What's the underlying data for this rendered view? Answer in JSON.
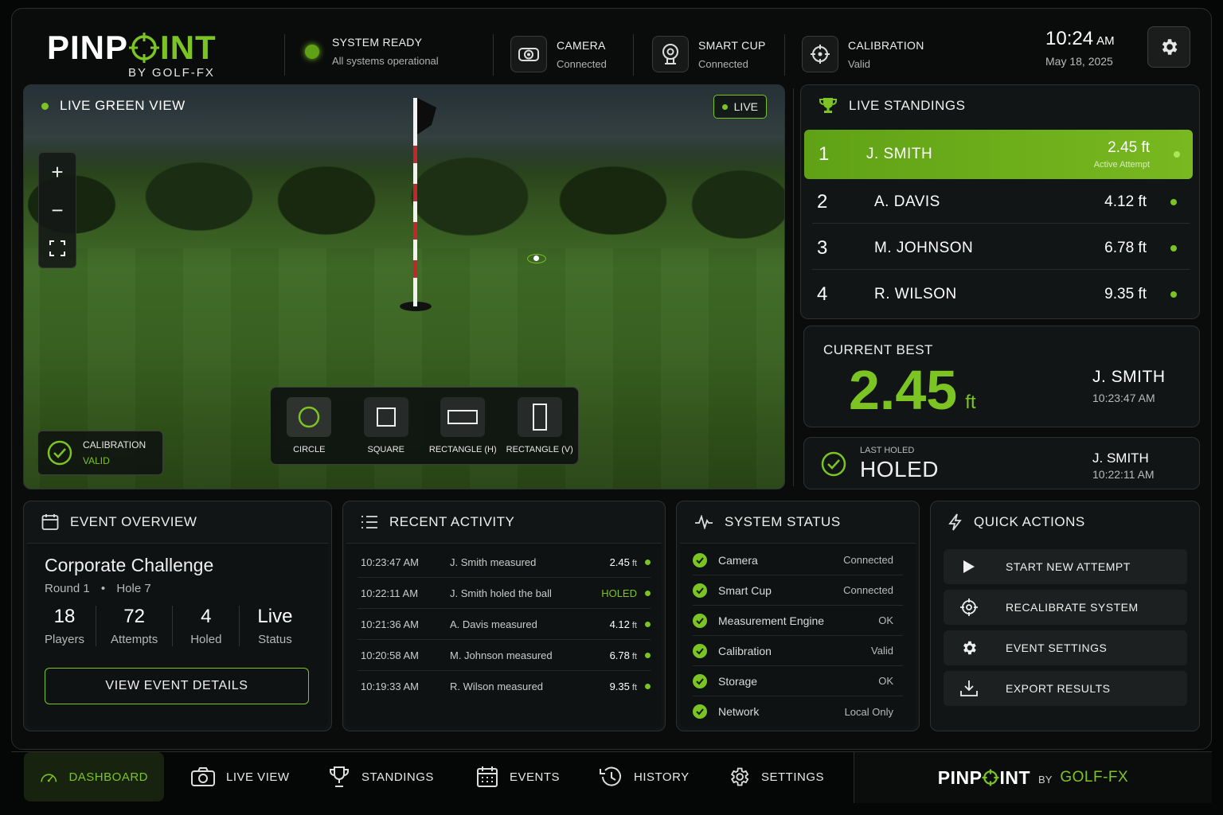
{
  "brand": {
    "name_a": "PINP",
    "name_b": "INT",
    "by": "BY GOLF-FX",
    "footer_by": "BY",
    "footer_brand": "GOLF-FX"
  },
  "header": {
    "system": {
      "title": "SYSTEM READY",
      "subtitle": "All systems operational"
    },
    "camera": {
      "title": "CAMERA",
      "subtitle": "Connected"
    },
    "cup": {
      "title": "SMART CUP",
      "subtitle": "Connected"
    },
    "calibration": {
      "title": "CALIBRATION",
      "subtitle": "Valid"
    },
    "time": "10:24",
    "ampm": "AM",
    "date": "May 18, 2025"
  },
  "green_view": {
    "title": "LIVE GREEN VIEW",
    "live_badge": "LIVE",
    "calibration": {
      "label": "CALIBRATION",
      "value": "VALID"
    },
    "shapes": [
      {
        "label": "CIRCLE",
        "icon": "circle-icon"
      },
      {
        "label": "SQUARE",
        "icon": "square-icon"
      },
      {
        "label": "RECTANGLE (H)",
        "icon": "rectangle-h-icon"
      },
      {
        "label": "RECTANGLE (V)",
        "icon": "rectangle-v-icon"
      }
    ]
  },
  "standings": {
    "title": "LIVE STANDINGS",
    "rows": [
      {
        "rank": "1",
        "name": "J. SMITH",
        "distance": "2.45 ft",
        "note": "Active Attempt"
      },
      {
        "rank": "2",
        "name": "A. DAVIS",
        "distance": "4.12 ft"
      },
      {
        "rank": "3",
        "name": "M. JOHNSON",
        "distance": "6.78 ft"
      },
      {
        "rank": "4",
        "name": "R. WILSON",
        "distance": "9.35 ft"
      }
    ]
  },
  "current_best": {
    "label": "CURRENT BEST",
    "value": "2.45",
    "unit": "ft",
    "name": "J. SMITH",
    "time": "10:23:47 AM"
  },
  "last_holed": {
    "label": "LAST HOLED",
    "value": "HOLED",
    "name": "J. SMITH",
    "time": "10:22:11 AM"
  },
  "event": {
    "title": "EVENT OVERVIEW",
    "name": "Corporate Challenge",
    "round": "Round 1",
    "hole": "Hole 7",
    "stats": [
      {
        "value": "18",
        "label": "Players"
      },
      {
        "value": "72",
        "label": "Attempts"
      },
      {
        "value": "4",
        "label": "Holed"
      },
      {
        "value": "Live",
        "label": "Status"
      }
    ],
    "button": "VIEW EVENT DETAILS"
  },
  "activity": {
    "title": "RECENT ACTIVITY",
    "rows": [
      {
        "time": "10:23:47 AM",
        "desc": "J. Smith measured",
        "value": "2.45",
        "unit": "ft"
      },
      {
        "time": "10:22:11 AM",
        "desc": "J. Smith holed the ball",
        "value": "HOLED",
        "unit": ""
      },
      {
        "time": "10:21:36 AM",
        "desc": "A. Davis measured",
        "value": "4.12",
        "unit": "ft"
      },
      {
        "time": "10:20:58 AM",
        "desc": "M. Johnson measured",
        "value": "6.78",
        "unit": "ft"
      },
      {
        "time": "10:19:33 AM",
        "desc": "R. Wilson measured",
        "value": "9.35",
        "unit": "ft"
      }
    ]
  },
  "system_status": {
    "title": "SYSTEM STATUS",
    "rows": [
      {
        "name": "Camera",
        "value": "Connected"
      },
      {
        "name": "Smart Cup",
        "value": "Connected"
      },
      {
        "name": "Measurement Engine",
        "value": "OK"
      },
      {
        "name": "Calibration",
        "value": "Valid"
      },
      {
        "name": "Storage",
        "value": "OK"
      },
      {
        "name": "Network",
        "value": "Local Only"
      }
    ]
  },
  "quick_actions": {
    "title": "QUICK ACTIONS",
    "buttons": [
      "START NEW ATTEMPT",
      "RECALIBRATE SYSTEM",
      "EVENT SETTINGS",
      "EXPORT RESULTS"
    ]
  },
  "nav": [
    "DASHBOARD",
    "LIVE VIEW",
    "STANDINGS",
    "EVENTS",
    "HISTORY",
    "SETTINGS"
  ],
  "colors": {
    "accent": "#7cc423",
    "background": "#0a0c0c",
    "panel": "#121515"
  }
}
